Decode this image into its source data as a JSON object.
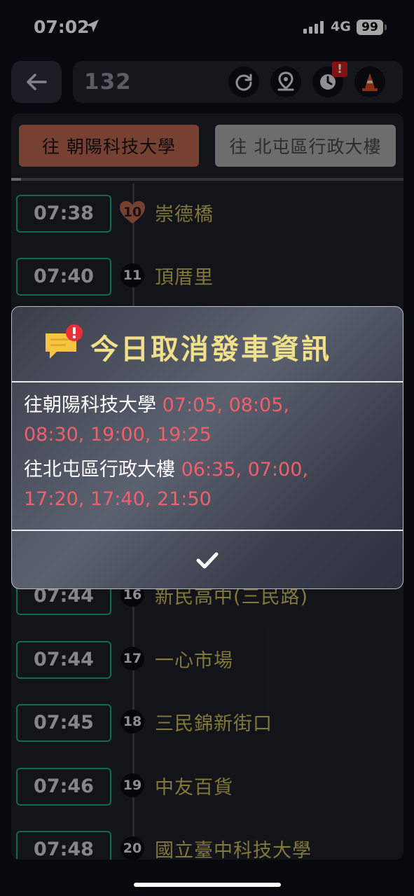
{
  "status_bar": {
    "time": "07:02",
    "network": "4G",
    "battery": "99"
  },
  "header": {
    "route_number": "132",
    "alert_badge": "!"
  },
  "tabs": {
    "active": "往  朝陽科技大學",
    "inactive": "往  北屯區行政大樓"
  },
  "stops": [
    {
      "time": "07:38",
      "seq": "10",
      "name": "崇德橋",
      "heart": true
    },
    {
      "time": "07:40",
      "seq": "11",
      "name": "頂厝里",
      "heart": false
    },
    {
      "time": "07:44",
      "seq": "16",
      "name": "新民高中(三民路)",
      "heart": false
    },
    {
      "time": "07:44",
      "seq": "17",
      "name": "一心市場",
      "heart": false
    },
    {
      "time": "07:45",
      "seq": "18",
      "name": "三民錦新街口",
      "heart": false
    },
    {
      "time": "07:46",
      "seq": "19",
      "name": "中友百貨",
      "heart": false
    },
    {
      "time": "07:48",
      "seq": "20",
      "name": "國立臺中科技大學",
      "heart": false
    }
  ],
  "modal": {
    "title": "今日取消發車資訊",
    "lines": [
      {
        "dest": "往朝陽科技大學",
        "times_1": "07:05, 08:05,",
        "times_2": "08:30, 19:00, 19:25"
      },
      {
        "dest": "往北屯區行政大樓",
        "times_1": "06:35, 07:00,",
        "times_2": "17:20, 17:40, 21:50"
      }
    ],
    "confirm_icon": "checkmark-icon"
  },
  "colors": {
    "accent_tab": "#b5654f",
    "time_border": "#19a37a",
    "stop_name": "#c8b858",
    "cancel_times": "#f0606a",
    "modal_title": "#f0e08a"
  }
}
